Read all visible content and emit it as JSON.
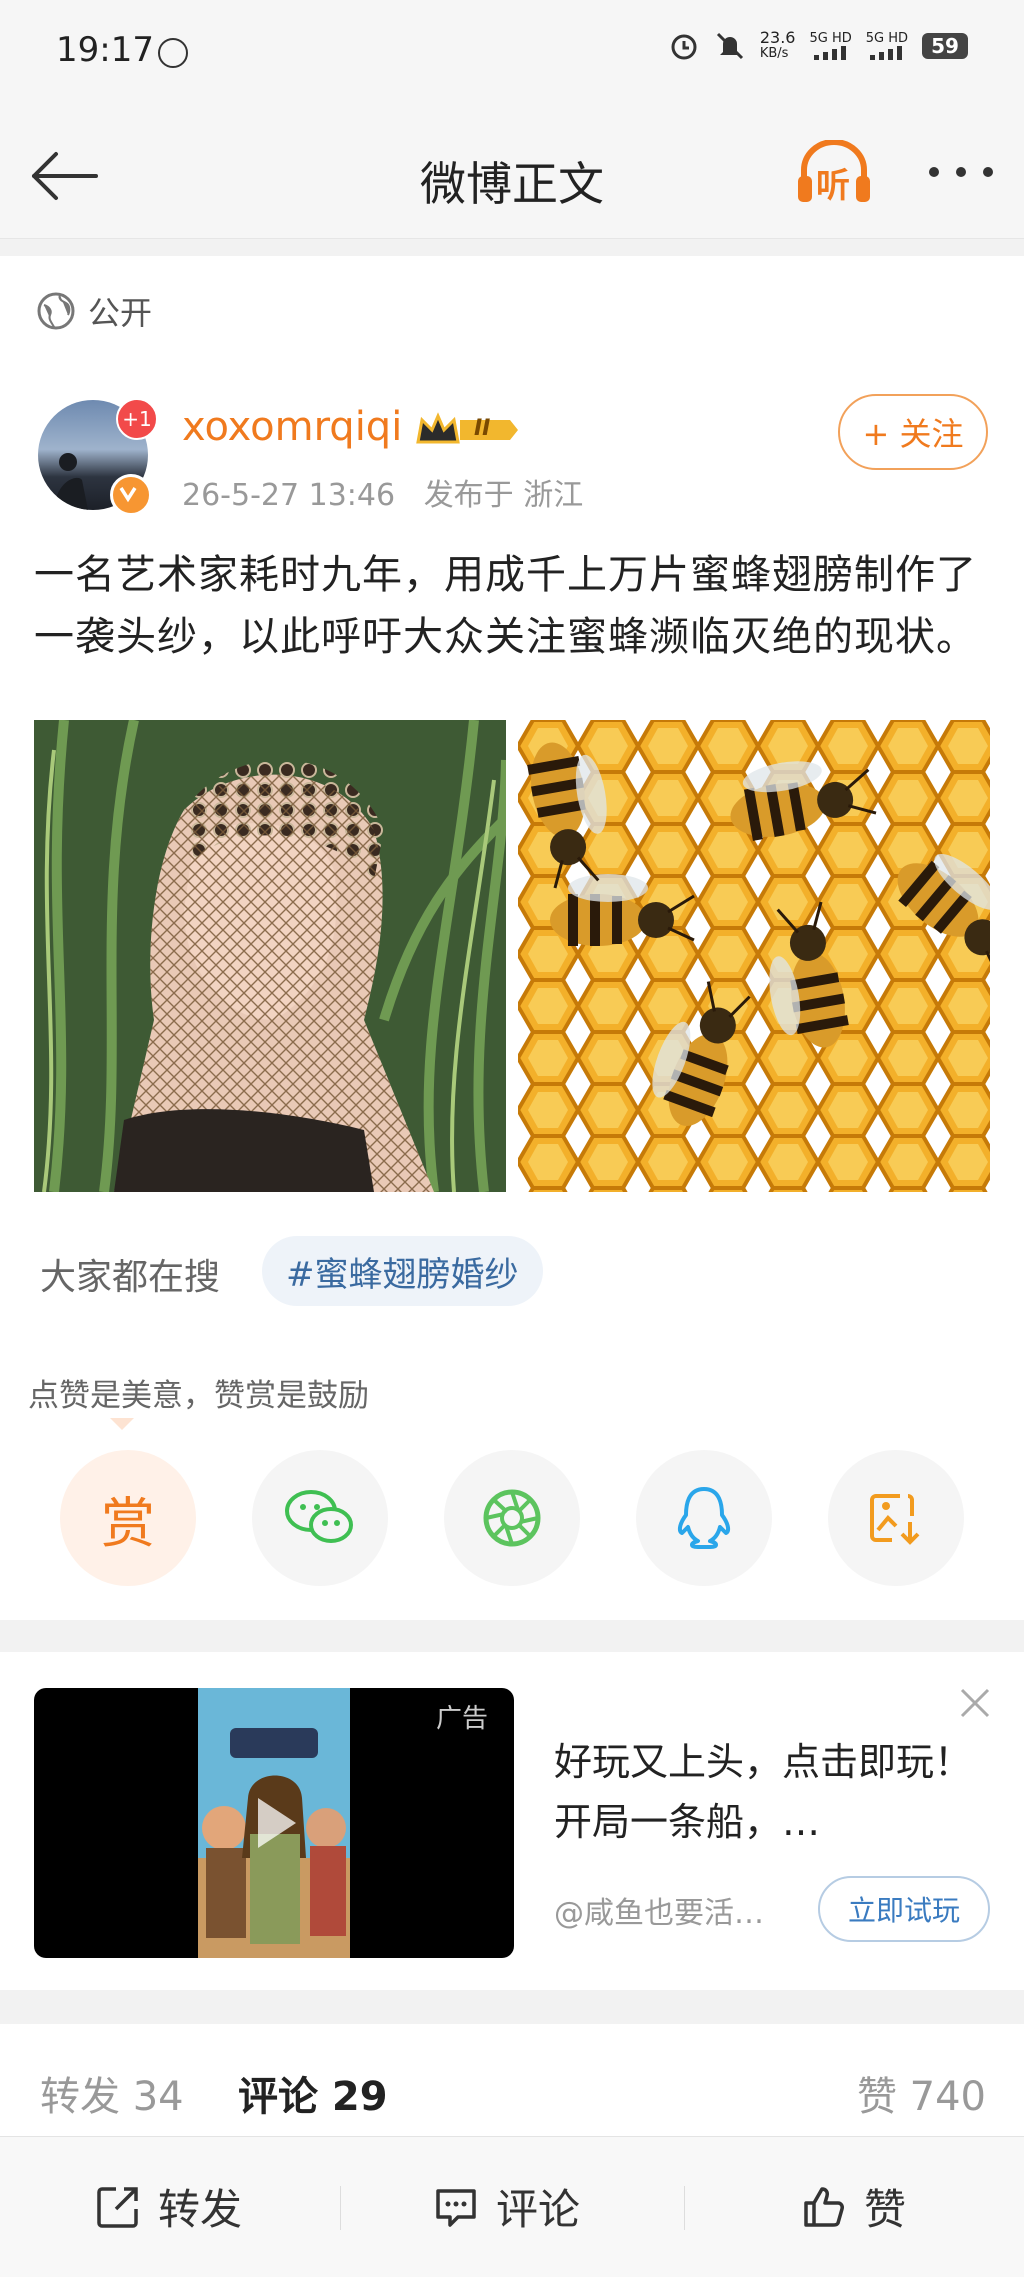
{
  "status_bar": {
    "time": "19:17",
    "net_speed": "23.6",
    "net_unit": "KB/s",
    "sig1": "5G HD",
    "sig2": "5G HD",
    "battery": "59"
  },
  "nav": {
    "title": "微博正文",
    "listen_label": "听"
  },
  "post": {
    "visibility": "公开",
    "author": {
      "name": "xoxomrqiqi",
      "notification_badge": "+1",
      "level_badge": "II"
    },
    "timestamp": "26-5-27 13:46",
    "location": "发布于 浙江",
    "follow_label": "+ 关注",
    "text": "一名艺术家耗时九年，用成千上万片蜜蜂翅膀制作了一袭头纱，以此呼吁大众关注蜜蜂濒临灭绝的现状。"
  },
  "trending": {
    "label": "大家都在搜",
    "tag": "#蜜蜂翅膀婚纱"
  },
  "reward": {
    "tip": "点赞是美意，赞赏是鼓励",
    "reward_glyph": "赏"
  },
  "share_icons": [
    "reward-icon",
    "wechat-icon",
    "moments-icon",
    "qq-icon",
    "save-image-icon"
  ],
  "ad": {
    "label": "广告",
    "title": "好玩又上头，点击即玩！开局一条船，…",
    "source": "@咸鱼也要活…",
    "button": "立即试玩"
  },
  "stats": {
    "repost": "转发 34",
    "comment": "评论 29",
    "like": "赞 740"
  },
  "bottom_bar": {
    "repost": "转发",
    "comment": "评论",
    "like": "赞"
  },
  "colors": {
    "accent": "#f07a1e",
    "link": "#3a7bc0"
  }
}
